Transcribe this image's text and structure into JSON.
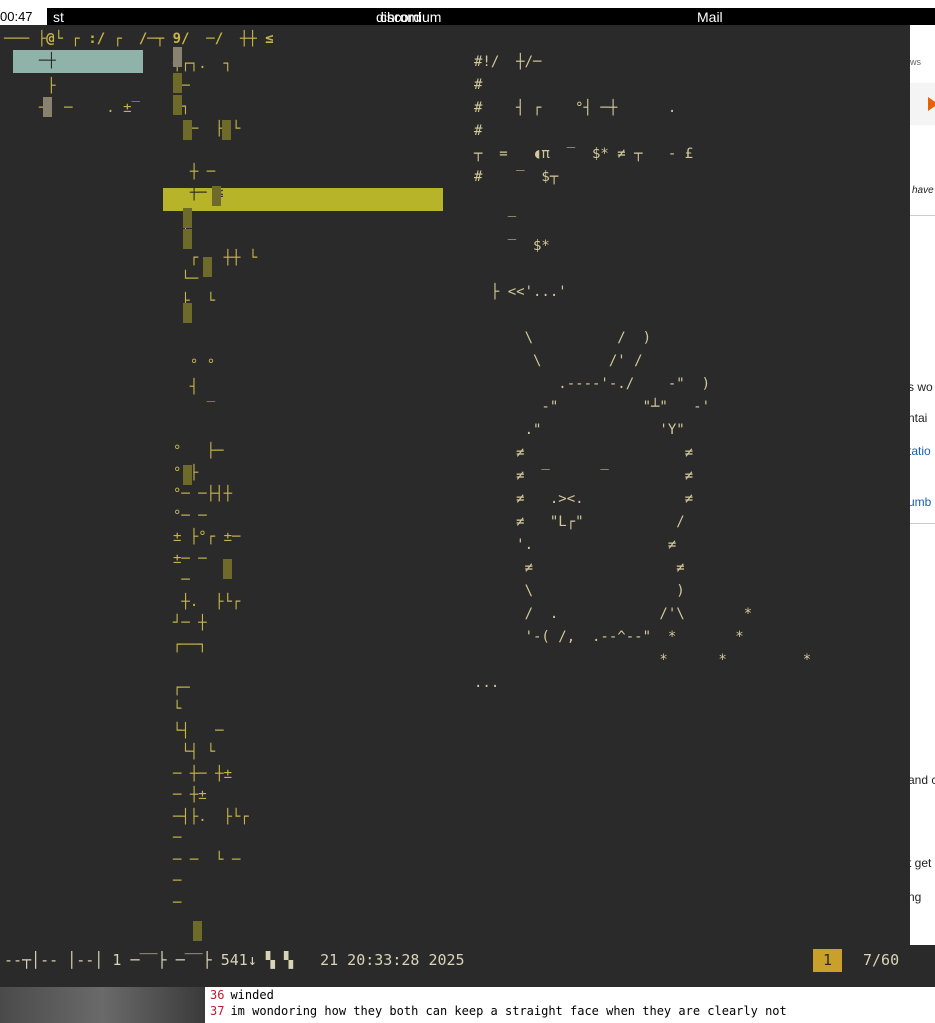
{
  "clock": "00:47",
  "titlebar": {
    "app": "st",
    "center_a": "discord",
    "center_b": "chromium",
    "right": "Mail"
  },
  "terminal": {
    "top_path": "─── ├@└ ┌ :/ ┌  /─┬ 9/  ─/  ┼┼ ≤",
    "left_list": [
      "  ─┼",
      "   ├  ",
      "  ─  ─    . ±‾"
    ],
    "mid_list": [
      "┬┌┐.  ┐",
      " ─     ",
      "┌┐",
      "  ─  ├ └",
      "  ",
      "  ┼ ─",
      "  ┼─ ≤",
      " ┌",
      " │",
      "  ┌   ┼┼ └",
      " └─",
      " ├  └",
      "  ",
      "   ",
      "  ° °",
      "  ┤",
      "    ‾",
      "  ",
      "°   ├─",
      "° ├",
      "°─ ─├┤┼ ",
      "°─ ─",
      "± ├°┌ ±─",
      "±─ ─",
      " ─ ",
      " ┼.  ├└┌",
      "┘─ ┼",
      "┌──┐",
      "",
      "┌─",
      "└",
      "└┤   ─",
      " └┤ └",
      "─ ┼─ ┼±",
      "─ ┼±",
      "─┤├.  ├└┌",
      "─  ",
      "─ ─  └ ─",
      "─",
      "─   "
    ],
    "right_text": [
      "#!/  ┼/─ ",
      "#",
      "#    ┤ ┌    °┤ ─┼      .",
      "#",
      "┬  =   ◖π  ‾  $* ≠ ┬   - £",
      "#    ‾  $┬",
      "",
      "    ‾",
      "    ‾  $*",
      "",
      "  ├ <<'...'",
      "",
      "      \\          /  )",
      "       \\        /' /",
      "          .----'-./    -\"  )",
      "        -\"          \"┴\"   -'",
      "      .\"              'Y\"",
      "     ≠                   ≠",
      "     ≠  ‾      ‾         ≠",
      "     ≠   .><.            ≠",
      "     ≠   \"L┌\"           /",
      "     '.                ≠",
      "      ≠                 ≠",
      "      \\                 )",
      "      /  .            /'\\       *",
      "      '-( /,  .--^--\"  *       *",
      "                      *      *         *",
      "..."
    ]
  },
  "status": {
    "left": "--┬│-- │--│ 1 ─‾‾├ ─‾‾├ 541↓ ▚ ▚   21 20:33:28 2025",
    "badge": "1",
    "position": "7/60"
  },
  "background_browser": {
    "frag_ws": "ws",
    "frag_have": "have",
    "frag_wo": "s wo",
    "frag_ntai": "ntai",
    "frag_tatio": "tatio",
    "frag_umb": "umb",
    "frag_and": "and c",
    "frag_get": "t get",
    "frag_ng": "ng"
  },
  "chat": {
    "lines": [
      {
        "num": "36",
        "text": "winded"
      },
      {
        "num": "37",
        "text": "im wondoring how they both can keep a straight face when they are clearly not"
      }
    ]
  }
}
